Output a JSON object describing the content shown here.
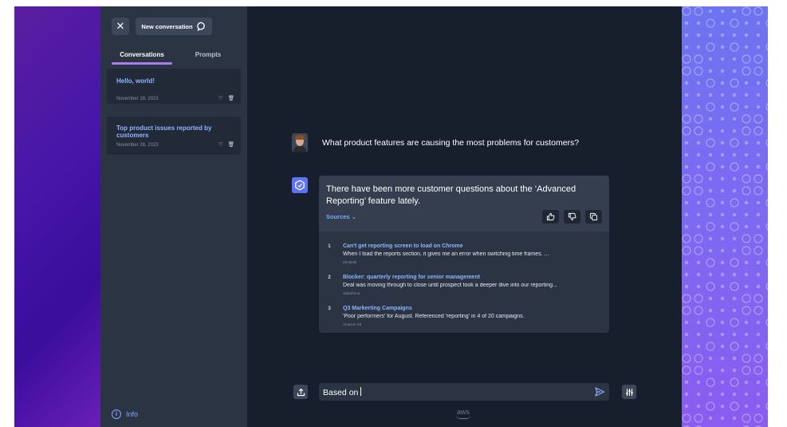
{
  "sidebar": {
    "close_icon": "close-icon",
    "new_conversation_label": "New conversation",
    "new_conversation_icon": "chat-bubble-icon",
    "tabs": [
      {
        "label": "Conversations",
        "active": true
      },
      {
        "label": "Prompts",
        "active": false
      }
    ],
    "conversations": [
      {
        "title": "Hello, world!",
        "date": "November 28, 2023"
      },
      {
        "title": "Top product issues reported by customers",
        "date": "November 28, 2023"
      }
    ],
    "info_label": "Info"
  },
  "chat": {
    "user_message": "What product features are causing the most problems for customers?",
    "answer": "There have been more customer questions about the ‘Advanced Reporting’ feature lately.",
    "sources_label": "Sources ⌄",
    "sources": [
      {
        "number": "1",
        "title": "Can't get reporting screen to load on Chrome",
        "snippet": "When I load the reports section, it gives me an error when switching time frames. ...",
        "origin": "Zendesk"
      },
      {
        "number": "2",
        "title": "Blocker: quarterly reporting for senior management",
        "snippet": "Deal was moving through to close until prospect took a deeper dive into our reporting...",
        "origin": "Salesforce"
      },
      {
        "number": "3",
        "title": "Q3 Markerting Campaigns",
        "snippet": "'Poor performers' for August. Referenced 'reporting' in 4 of 20 campaigns.",
        "origin": "Amazon S3"
      }
    ],
    "input_value": "Based on",
    "footer_logo": "aws"
  },
  "colors": {
    "sidebar_bg": "#2b3443",
    "main_bg": "#171f2d",
    "accent_link": "#8fb4ff",
    "tab_underline": "#a97cf0",
    "ai_avatar": "#5d73f3"
  }
}
